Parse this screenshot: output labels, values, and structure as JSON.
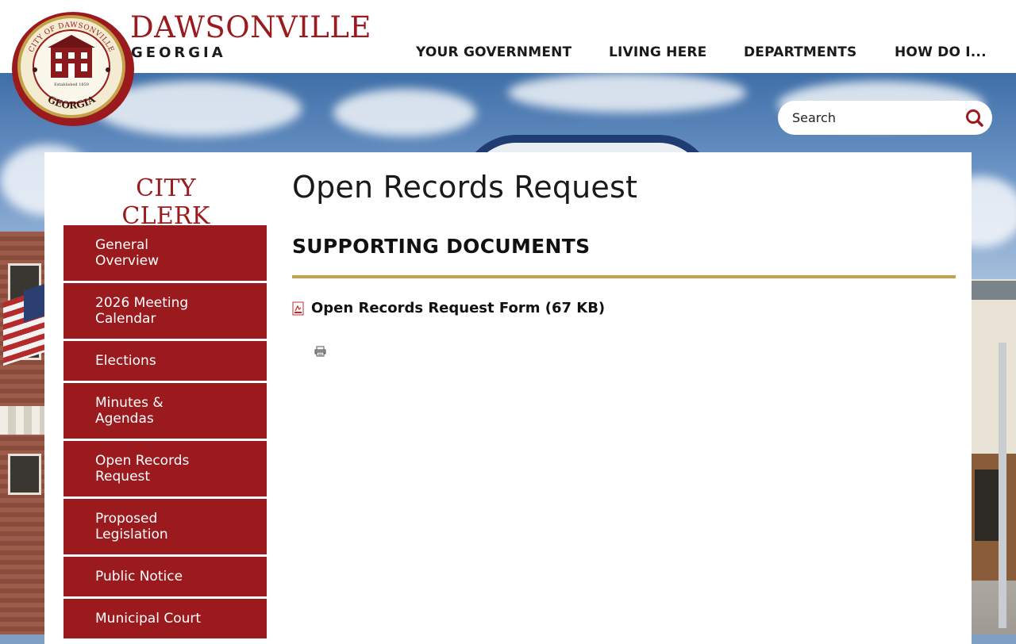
{
  "brand": {
    "name": "DAWSONVILLE",
    "state": "GEORGIA",
    "seal_text_top": "CITY OF DAWSONVILLE",
    "seal_text_bottom": "GEORGIA",
    "seal_established": "Established 1859"
  },
  "nav": {
    "items": [
      {
        "label": "YOUR GOVERNMENT"
      },
      {
        "label": "LIVING HERE"
      },
      {
        "label": "DEPARTMENTS"
      },
      {
        "label": "HOW DO I..."
      }
    ]
  },
  "search": {
    "placeholder": "Search",
    "icon": "search-icon"
  },
  "sidebar": {
    "title": "CITY CLERK",
    "items": [
      {
        "label": "General Overview"
      },
      {
        "label": "2026 Meeting Calendar"
      },
      {
        "label": "Elections"
      },
      {
        "label": "Minutes & Agendas"
      },
      {
        "label": "Open Records Request"
      },
      {
        "label": "Proposed Legislation"
      },
      {
        "label": "Public Notice"
      },
      {
        "label": "Municipal Court"
      }
    ]
  },
  "main": {
    "title": "Open Records Request",
    "section_heading": "SUPPORTING DOCUMENTS",
    "documents": [
      {
        "label": "Open Records Request Form (67 KB)",
        "icon": "pdf-icon"
      }
    ],
    "print_icon": "print-icon"
  },
  "colors": {
    "brand_red": "#9b1a1e",
    "gold_rule": "#c4a24a",
    "header_bg": "#ffffff",
    "text_dark": "#1a1a1a"
  }
}
